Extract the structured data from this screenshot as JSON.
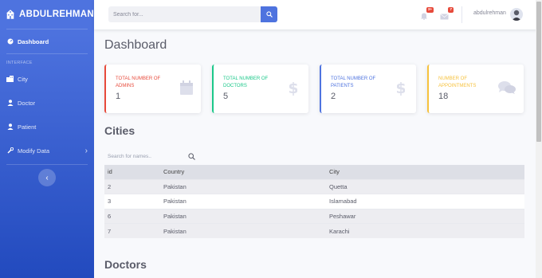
{
  "sidebar": {
    "brand": "ABDULREHMAN",
    "items": [
      {
        "label": "Dashboard"
      },
      {
        "label": "City"
      },
      {
        "label": "Doctor"
      },
      {
        "label": "Patient"
      },
      {
        "label": "Modify Data"
      }
    ],
    "heading": "INTERFACE"
  },
  "topbar": {
    "search_placeholder": "Search for...",
    "alerts_count": "3+",
    "messages_count": "7",
    "username": "abdulrehman"
  },
  "main": {
    "title": "Dashboard",
    "cards": [
      {
        "label": "TOTAL NUMBER OF ADMINS",
        "value": "1",
        "color": "#e74a3b",
        "icon": "calendar-icon"
      },
      {
        "label": "TOTAL NUMBER OF DOCTORS",
        "value": "5",
        "color": "#1cc88a",
        "icon": "dollar-icon"
      },
      {
        "label": "TOTAL NUMBER OF PATIENTS",
        "value": "2",
        "color": "#4e73df",
        "icon": "dollar-icon"
      },
      {
        "label": "NUMBER OF APPOINTMENTS",
        "value": "18",
        "color": "#f6c23e",
        "icon": "comments-icon"
      }
    ],
    "cities": {
      "title": "Cities",
      "search_placeholder": "Search for names..",
      "headers": [
        "id",
        "Country",
        "City"
      ],
      "rows": [
        [
          "2",
          "Pakistan",
          "Quetta"
        ],
        [
          "3",
          "Pakistan",
          "Islamabad"
        ],
        [
          "6",
          "Pakistan",
          "Peshawar"
        ],
        [
          "7",
          "Pakistan",
          "Karachi"
        ]
      ]
    },
    "doctors_title": "Doctors"
  },
  "colors": {
    "primary": "#4e73df",
    "danger": "#e74a3b",
    "success": "#1cc88a",
    "warning": "#f6c23e"
  }
}
